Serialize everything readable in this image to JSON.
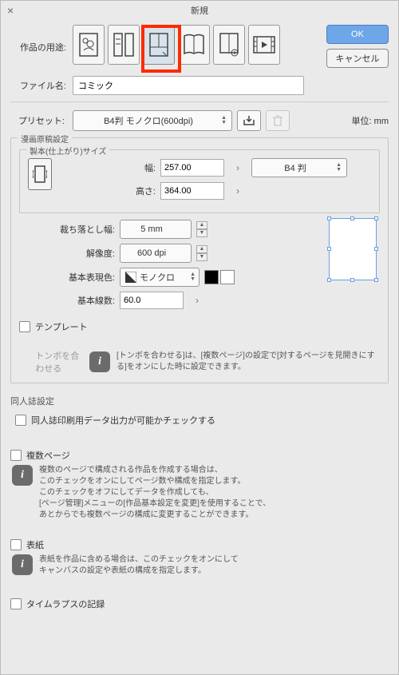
{
  "dialog": {
    "title": "新規"
  },
  "labels": {
    "use": "作品の用途:",
    "filename": "ファイル名:",
    "preset": "プリセット:",
    "unit": "単位: mm",
    "manga_group": "漫画原稿設定",
    "binding_group": "製本(仕上がり)サイズ",
    "width": "幅:",
    "height": "高さ:",
    "bleed": "裁ち落とし幅:",
    "resolution": "解像度:",
    "basic_color": "基本表現色:",
    "basic_lines": "基本線数:",
    "template": "テンプレート",
    "trim_align": "トンボを合わせる",
    "doujin_group": "同人誌設定",
    "doujin_check": "同人誌印刷用データ出力が可能かチェックする",
    "multipage": "複数ページ",
    "cover": "表紙",
    "timelapse": "タイムラプスの記録"
  },
  "values": {
    "filename": "コミック",
    "preset": "B4判 モノクロ(600dpi)",
    "width": "257.00",
    "height": "364.00",
    "size_preset": "B4 判",
    "bleed": "5 mm",
    "resolution": "600 dpi",
    "color_mode": "モノクロ",
    "lines": "60.0"
  },
  "buttons": {
    "ok": "OK",
    "cancel": "キャンセル"
  },
  "info": {
    "trim": "[トンボを合わせる]は、[複数ページ]の設定で[対するページを見開きにする]をオンにした時に設定できます。",
    "multipage": "複数のページで構成される作品を作成する場合は、\nこのチェックをオンにしてページ数や構成を指定します。\nこのチェックをオフにしてデータを作成しても、\n[ページ管理]メニューの[作品基本設定を変更]を使用することで、\nあとからでも複数ページの構成に変更することができます。",
    "cover": "表紙を作品に含める場合は、このチェックをオンにして\nキャンバスの設定や表紙の構成を指定します。"
  }
}
